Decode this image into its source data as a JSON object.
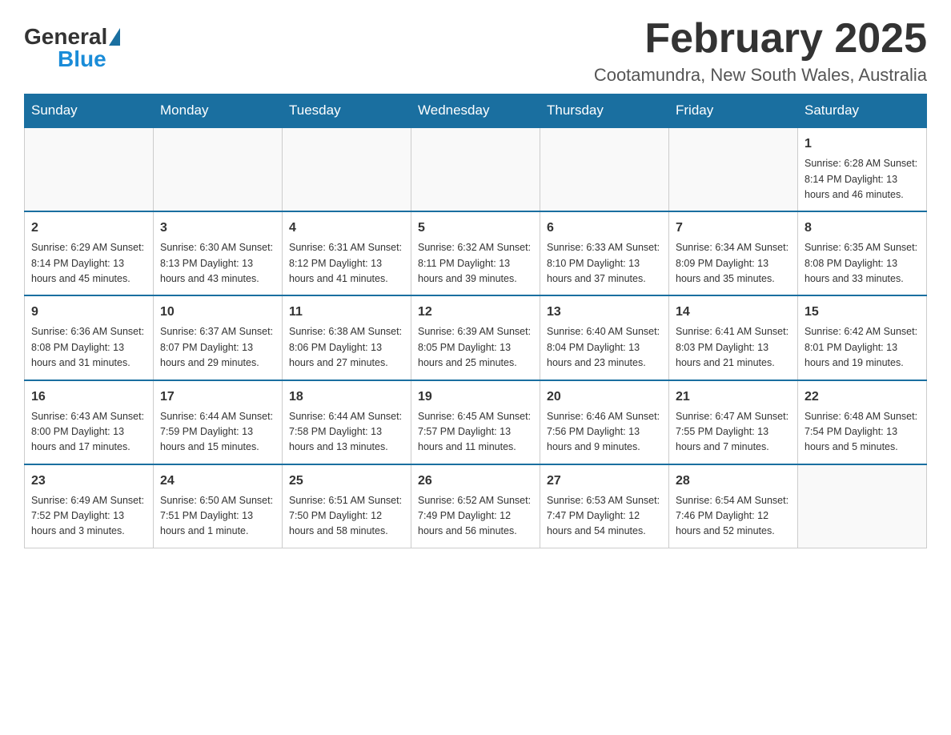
{
  "header": {
    "logo": {
      "general": "General",
      "blue": "Blue"
    },
    "title": "February 2025",
    "location": "Cootamundra, New South Wales, Australia"
  },
  "days_of_week": [
    "Sunday",
    "Monday",
    "Tuesday",
    "Wednesday",
    "Thursday",
    "Friday",
    "Saturday"
  ],
  "weeks": [
    [
      {
        "day": "",
        "info": ""
      },
      {
        "day": "",
        "info": ""
      },
      {
        "day": "",
        "info": ""
      },
      {
        "day": "",
        "info": ""
      },
      {
        "day": "",
        "info": ""
      },
      {
        "day": "",
        "info": ""
      },
      {
        "day": "1",
        "info": "Sunrise: 6:28 AM\nSunset: 8:14 PM\nDaylight: 13 hours and 46 minutes."
      }
    ],
    [
      {
        "day": "2",
        "info": "Sunrise: 6:29 AM\nSunset: 8:14 PM\nDaylight: 13 hours and 45 minutes."
      },
      {
        "day": "3",
        "info": "Sunrise: 6:30 AM\nSunset: 8:13 PM\nDaylight: 13 hours and 43 minutes."
      },
      {
        "day": "4",
        "info": "Sunrise: 6:31 AM\nSunset: 8:12 PM\nDaylight: 13 hours and 41 minutes."
      },
      {
        "day": "5",
        "info": "Sunrise: 6:32 AM\nSunset: 8:11 PM\nDaylight: 13 hours and 39 minutes."
      },
      {
        "day": "6",
        "info": "Sunrise: 6:33 AM\nSunset: 8:10 PM\nDaylight: 13 hours and 37 minutes."
      },
      {
        "day": "7",
        "info": "Sunrise: 6:34 AM\nSunset: 8:09 PM\nDaylight: 13 hours and 35 minutes."
      },
      {
        "day": "8",
        "info": "Sunrise: 6:35 AM\nSunset: 8:08 PM\nDaylight: 13 hours and 33 minutes."
      }
    ],
    [
      {
        "day": "9",
        "info": "Sunrise: 6:36 AM\nSunset: 8:08 PM\nDaylight: 13 hours and 31 minutes."
      },
      {
        "day": "10",
        "info": "Sunrise: 6:37 AM\nSunset: 8:07 PM\nDaylight: 13 hours and 29 minutes."
      },
      {
        "day": "11",
        "info": "Sunrise: 6:38 AM\nSunset: 8:06 PM\nDaylight: 13 hours and 27 minutes."
      },
      {
        "day": "12",
        "info": "Sunrise: 6:39 AM\nSunset: 8:05 PM\nDaylight: 13 hours and 25 minutes."
      },
      {
        "day": "13",
        "info": "Sunrise: 6:40 AM\nSunset: 8:04 PM\nDaylight: 13 hours and 23 minutes."
      },
      {
        "day": "14",
        "info": "Sunrise: 6:41 AM\nSunset: 8:03 PM\nDaylight: 13 hours and 21 minutes."
      },
      {
        "day": "15",
        "info": "Sunrise: 6:42 AM\nSunset: 8:01 PM\nDaylight: 13 hours and 19 minutes."
      }
    ],
    [
      {
        "day": "16",
        "info": "Sunrise: 6:43 AM\nSunset: 8:00 PM\nDaylight: 13 hours and 17 minutes."
      },
      {
        "day": "17",
        "info": "Sunrise: 6:44 AM\nSunset: 7:59 PM\nDaylight: 13 hours and 15 minutes."
      },
      {
        "day": "18",
        "info": "Sunrise: 6:44 AM\nSunset: 7:58 PM\nDaylight: 13 hours and 13 minutes."
      },
      {
        "day": "19",
        "info": "Sunrise: 6:45 AM\nSunset: 7:57 PM\nDaylight: 13 hours and 11 minutes."
      },
      {
        "day": "20",
        "info": "Sunrise: 6:46 AM\nSunset: 7:56 PM\nDaylight: 13 hours and 9 minutes."
      },
      {
        "day": "21",
        "info": "Sunrise: 6:47 AM\nSunset: 7:55 PM\nDaylight: 13 hours and 7 minutes."
      },
      {
        "day": "22",
        "info": "Sunrise: 6:48 AM\nSunset: 7:54 PM\nDaylight: 13 hours and 5 minutes."
      }
    ],
    [
      {
        "day": "23",
        "info": "Sunrise: 6:49 AM\nSunset: 7:52 PM\nDaylight: 13 hours and 3 minutes."
      },
      {
        "day": "24",
        "info": "Sunrise: 6:50 AM\nSunset: 7:51 PM\nDaylight: 13 hours and 1 minute."
      },
      {
        "day": "25",
        "info": "Sunrise: 6:51 AM\nSunset: 7:50 PM\nDaylight: 12 hours and 58 minutes."
      },
      {
        "day": "26",
        "info": "Sunrise: 6:52 AM\nSunset: 7:49 PM\nDaylight: 12 hours and 56 minutes."
      },
      {
        "day": "27",
        "info": "Sunrise: 6:53 AM\nSunset: 7:47 PM\nDaylight: 12 hours and 54 minutes."
      },
      {
        "day": "28",
        "info": "Sunrise: 6:54 AM\nSunset: 7:46 PM\nDaylight: 12 hours and 52 minutes."
      },
      {
        "day": "",
        "info": ""
      }
    ]
  ]
}
